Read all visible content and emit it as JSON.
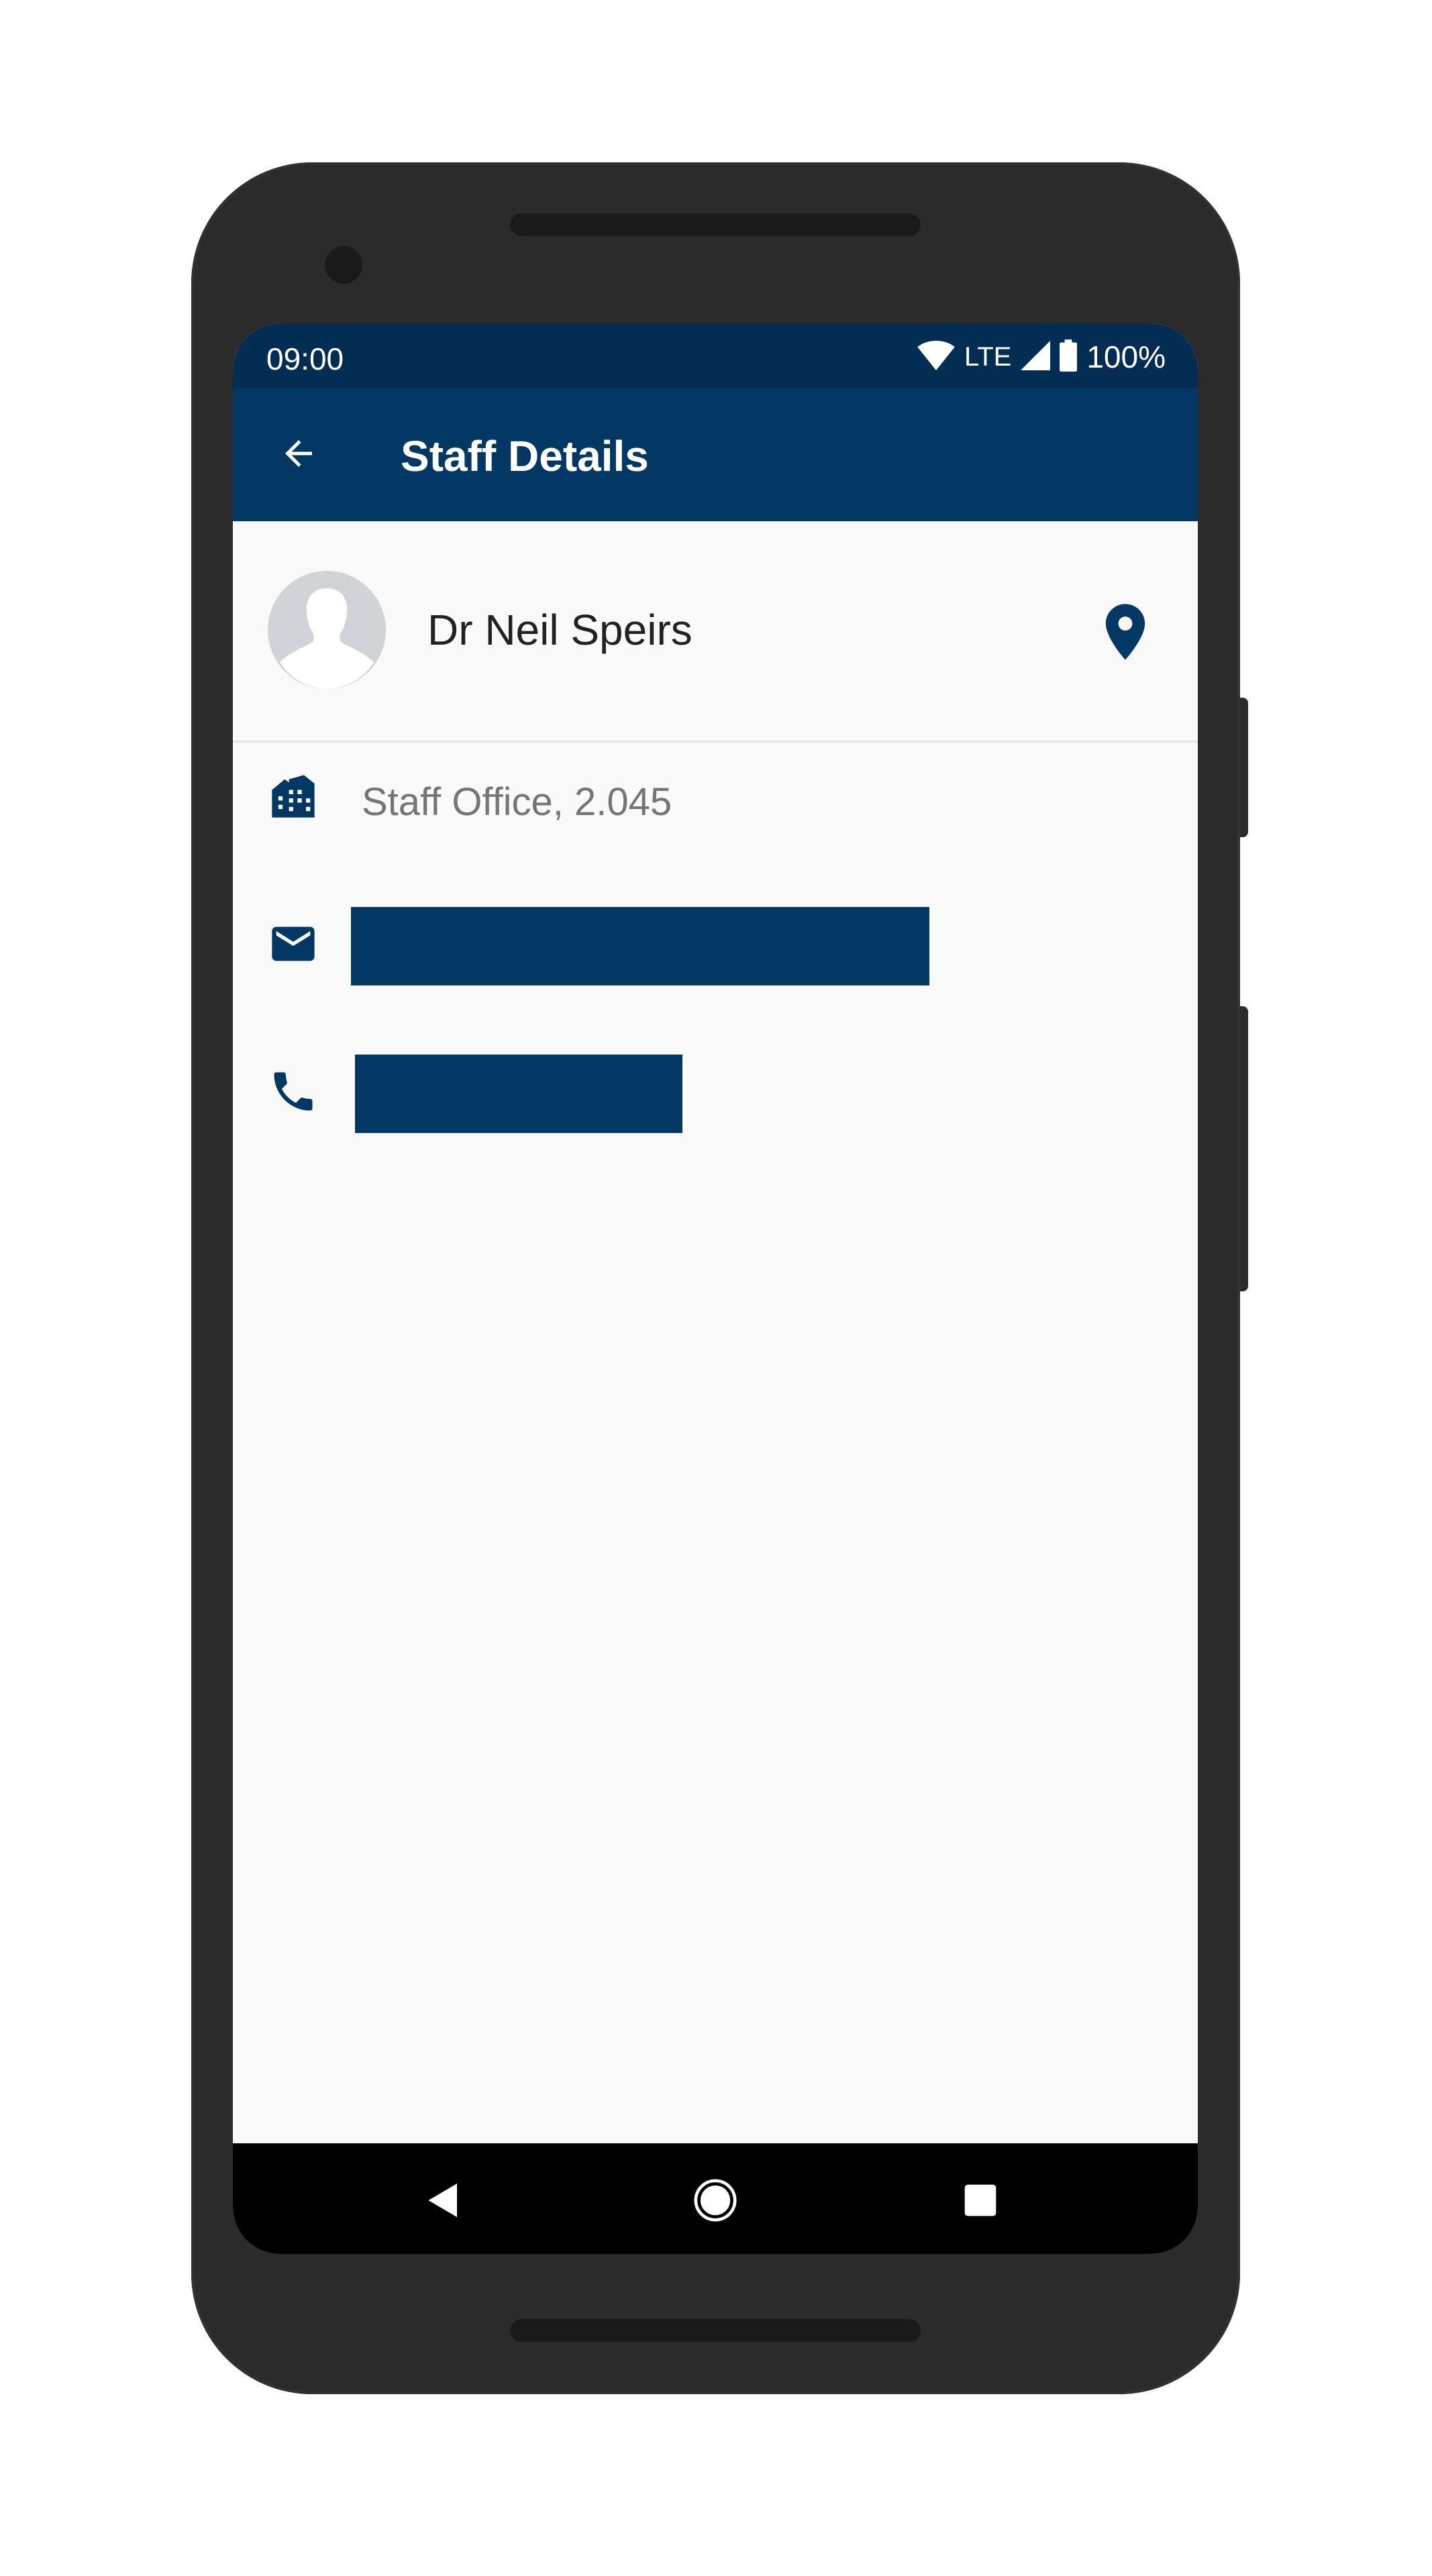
{
  "status_bar": {
    "time": "09:00",
    "network": "LTE",
    "battery": "100%"
  },
  "app_bar": {
    "title": "Staff Details",
    "back_icon": "arrow-back-icon"
  },
  "staff": {
    "name": "Dr Neil Speirs",
    "avatar_icon": "person-silhouette-icon",
    "location_icon": "location-pin-icon",
    "office": "Staff Office, 2.045",
    "office_icon": "building-icon",
    "email_icon": "mail-icon",
    "phone_icon": "phone-icon"
  },
  "nav_bar": {
    "back_icon": "nav-back-icon",
    "home_icon": "nav-home-icon",
    "recent_icon": "nav-recents-icon"
  },
  "colors": {
    "primary": "#033864",
    "status_bar": "#032d52",
    "background": "#f9f9f9",
    "text_primary": "#222222",
    "text_secondary": "#757575"
  }
}
